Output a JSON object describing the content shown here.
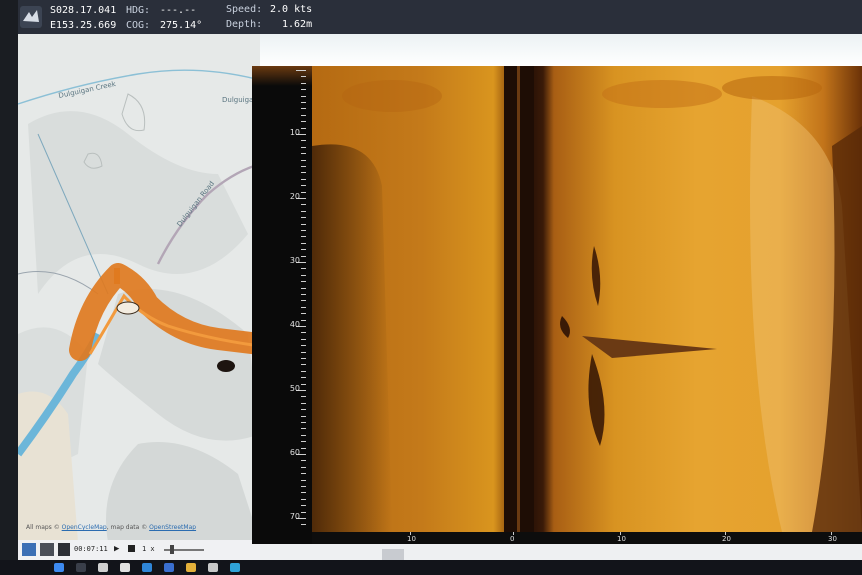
{
  "status": {
    "lat": "S028.17.041",
    "lon": "E153.25.669",
    "hdg_label": "HDG:",
    "hdg_value": "---.--",
    "cog_label": "COG:",
    "cog_value": "275.14°",
    "speed_label": "Speed:",
    "speed_value": "2.0 kts",
    "depth_label": "Depth:",
    "depth_value": "1.62m"
  },
  "map": {
    "labels": [
      "Dulguigan Creek",
      "Dulguiga",
      "Dulguigan Road"
    ],
    "attribution_prefix": "All maps ©",
    "attribution_link1": "OpenCycleMap",
    "attribution_mid": ", map data ©",
    "attribution_link2": "OpenStreetMap"
  },
  "playback": {
    "time": "00:07:11",
    "speed": "1 x"
  },
  "depth_scale": {
    "ticks": [
      "10",
      "20",
      "30",
      "40",
      "50",
      "60",
      "70"
    ]
  },
  "sonar_x_axis": {
    "ticks": [
      "10",
      "0",
      "10",
      "20",
      "30"
    ]
  },
  "colors": {
    "track": "#e07a1f",
    "creek": "#6cb6d9",
    "sonar_dark": "#2a1206",
    "sonar_bright": "#e6a430"
  }
}
